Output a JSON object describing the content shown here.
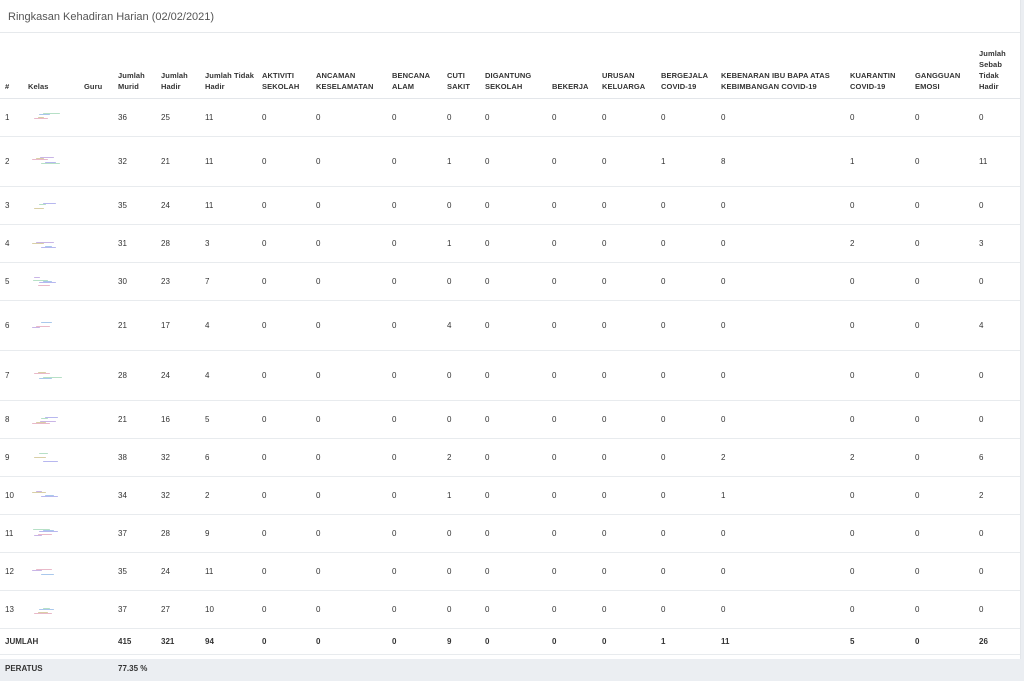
{
  "panel": {
    "title": "Ringkasan Kehadiran Harian (02/02/2021)"
  },
  "table": {
    "columns": [
      "#",
      "Kelas",
      "Guru",
      "Jumlah Murid",
      "Jumlah Hadir",
      "Jumlah Tidak Hadir",
      "AKTIVITI SEKOLAH",
      "ANCAMAN KESELAMATAN",
      "BENCANA ALAM",
      "CUTI SAKIT",
      "DIGANTUNG SEKOLAH",
      "BEKERJA",
      "URUSAN KELUARGA",
      "BERGEJALA COVID-19",
      "KEBENARAN IBU BAPA ATAS KEBIMBANGAN COVID-19",
      "KUARANTIN COVID-19",
      "GANGGUAN EMOSI",
      "Jumlah Sebab Tidak Hadir"
    ],
    "rows": [
      [
        "1",
        "",
        "",
        "36",
        "25",
        "11",
        "0",
        "0",
        "0",
        "0",
        "0",
        "0",
        "0",
        "0",
        "0",
        "0",
        "0",
        "0"
      ],
      [
        "2",
        "",
        "",
        "32",
        "21",
        "11",
        "0",
        "0",
        "0",
        "1",
        "0",
        "0",
        "0",
        "1",
        "8",
        "1",
        "0",
        "11"
      ],
      [
        "3",
        "",
        "",
        "35",
        "24",
        "11",
        "0",
        "0",
        "0",
        "0",
        "0",
        "0",
        "0",
        "0",
        "0",
        "0",
        "0",
        "0"
      ],
      [
        "4",
        "",
        "",
        "31",
        "28",
        "3",
        "0",
        "0",
        "0",
        "1",
        "0",
        "0",
        "0",
        "0",
        "0",
        "2",
        "0",
        "3"
      ],
      [
        "5",
        "",
        "",
        "30",
        "23",
        "7",
        "0",
        "0",
        "0",
        "0",
        "0",
        "0",
        "0",
        "0",
        "0",
        "0",
        "0",
        "0"
      ],
      [
        "6",
        "",
        "",
        "21",
        "17",
        "4",
        "0",
        "0",
        "0",
        "4",
        "0",
        "0",
        "0",
        "0",
        "0",
        "0",
        "0",
        "4"
      ],
      [
        "7",
        "",
        "",
        "28",
        "24",
        "4",
        "0",
        "0",
        "0",
        "0",
        "0",
        "0",
        "0",
        "0",
        "0",
        "0",
        "0",
        "0"
      ],
      [
        "8",
        "",
        "",
        "21",
        "16",
        "5",
        "0",
        "0",
        "0",
        "0",
        "0",
        "0",
        "0",
        "0",
        "0",
        "0",
        "0",
        "0"
      ],
      [
        "9",
        "",
        "",
        "38",
        "32",
        "6",
        "0",
        "0",
        "0",
        "2",
        "0",
        "0",
        "0",
        "0",
        "2",
        "2",
        "0",
        "6"
      ],
      [
        "10",
        "",
        "",
        "34",
        "32",
        "2",
        "0",
        "0",
        "0",
        "1",
        "0",
        "0",
        "0",
        "0",
        "1",
        "0",
        "0",
        "2"
      ],
      [
        "11",
        "",
        "",
        "37",
        "28",
        "9",
        "0",
        "0",
        "0",
        "0",
        "0",
        "0",
        "0",
        "0",
        "0",
        "0",
        "0",
        "0"
      ],
      [
        "12",
        "",
        "",
        "35",
        "24",
        "11",
        "0",
        "0",
        "0",
        "0",
        "0",
        "0",
        "0",
        "0",
        "0",
        "0",
        "0",
        "0"
      ],
      [
        "13",
        "",
        "",
        "37",
        "27",
        "10",
        "0",
        "0",
        "0",
        "0",
        "0",
        "0",
        "0",
        "0",
        "0",
        "0",
        "0",
        "0"
      ]
    ],
    "total_row": [
      "JUMLAH",
      "",
      "",
      "415",
      "321",
      "94",
      "0",
      "0",
      "0",
      "9",
      "0",
      "0",
      "0",
      "1",
      "11",
      "5",
      "0",
      "26"
    ],
    "percent_row": {
      "label": "PERATUS",
      "value": "77.35 %"
    }
  },
  "colors": {
    "page_bg": "#ebeef2",
    "panel_bg": "#ffffff",
    "border": "#e3e6ea",
    "text": "#333333"
  }
}
